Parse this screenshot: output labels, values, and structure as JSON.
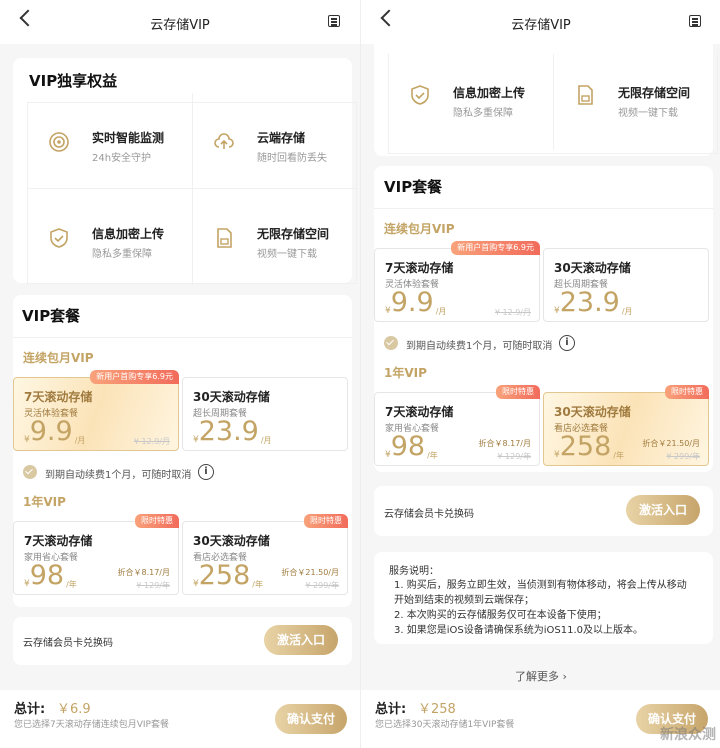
{
  "nav": {
    "title": "云存储VIP"
  },
  "left": {
    "benefits": {
      "heading": "VIP独享权益",
      "items": [
        {
          "title": "实时智能监测",
          "sub": "24h安全守护",
          "icon": "target-icon"
        },
        {
          "title": "云端存储",
          "sub": "随时回看防丢失",
          "icon": "cloud-upload-icon"
        },
        {
          "title": "信息加密上传",
          "sub": "隐私多重保障",
          "icon": "shield-check-icon"
        },
        {
          "title": "无限存储空间",
          "sub": "视频一键下载",
          "icon": "sd-card-icon"
        }
      ]
    },
    "packages": {
      "heading": "VIP套餐",
      "monthly_label": "连续包月VIP",
      "yearly_label": "1年VIP",
      "monthly": [
        {
          "name": "7天滚动存储",
          "desc": "灵活体验套餐",
          "cur": "¥",
          "price": "9.9",
          "unit": "/月",
          "orig": "¥ 12.9/月",
          "badge": "新用户首购专享6.9元"
        },
        {
          "name": "30天滚动存储",
          "desc": "超长周期套餐",
          "cur": "¥",
          "price": "23.9",
          "unit": "/月"
        }
      ],
      "renew_text": "到期自动续费1个月，可随时取消",
      "yearly": [
        {
          "name": "7天滚动存储",
          "desc": "家用省心套餐",
          "cur": "¥",
          "price": "98",
          "unit": "/年",
          "eq": "折合￥8.17/月",
          "orig": "¥ 129/年",
          "badge": "限时特惠"
        },
        {
          "name": "30天滚动存储",
          "desc": "看店必选套餐",
          "cur": "¥",
          "price": "258",
          "unit": "/年",
          "eq": "折合￥21.50/月",
          "orig": "¥ 299/年",
          "badge": "限时特惠"
        }
      ]
    },
    "redeem": {
      "label": "云存储会员卡兑换码",
      "button": "激活入口"
    },
    "footer": {
      "total_label": "总计:",
      "total_value": "￥6.9",
      "note": "您已选择7天滚动存储连续包月VIP套餐",
      "confirm": "确认支付"
    }
  },
  "right": {
    "benefits_partial": [
      {
        "title": "信息加密上传",
        "sub": "隐私多重保障",
        "icon": "shield-check-icon"
      },
      {
        "title": "无限存储空间",
        "sub": "视频一键下载",
        "icon": "sd-card-icon"
      }
    ],
    "packages": {
      "heading": "VIP套餐",
      "monthly_label": "连续包月VIP",
      "yearly_label": "1年VIP",
      "monthly": [
        {
          "name": "7天滚动存储",
          "desc": "灵活体验套餐",
          "cur": "¥",
          "price": "9.9",
          "unit": "/月",
          "orig": "¥ 12.9/月",
          "badge": "新用户首购专享6.9元"
        },
        {
          "name": "30天滚动存储",
          "desc": "超长周期套餐",
          "cur": "¥",
          "price": "23.9",
          "unit": "/月"
        }
      ],
      "renew_text": "到期自动续费1个月，可随时取消",
      "yearly": [
        {
          "name": "7天滚动存储",
          "desc": "家用省心套餐",
          "cur": "¥",
          "price": "98",
          "unit": "/年",
          "eq": "折合￥8.17/月",
          "orig": "¥ 129/年",
          "badge": "限时特惠"
        },
        {
          "name": "30天滚动存储",
          "desc": "看店必选套餐",
          "cur": "¥",
          "price": "258",
          "unit": "/年",
          "eq": "折合￥21.50/月",
          "orig": "¥ 299/年",
          "badge": "限时特惠"
        }
      ]
    },
    "redeem": {
      "label": "云存储会员卡兑换码",
      "button": "激活入口"
    },
    "service": {
      "title": "服务说明：",
      "items": [
        "1. 购买后，服务立即生效，当侦测到有物体移动，将会上传从移动开始到结束的视频到云端保存；",
        "2. 本次购买的云存储服务仅可在本设备下使用；",
        "3. 如果您是iOS设备请确保系统为iOS11.0及以上版本。"
      ]
    },
    "more": "了解更多",
    "footer": {
      "total_label": "总计:",
      "total_value": "￥258",
      "note": "您已选择30天滚动存储1年VIP套餐",
      "confirm": "确认支付"
    }
  },
  "watermark": "新浪众测"
}
